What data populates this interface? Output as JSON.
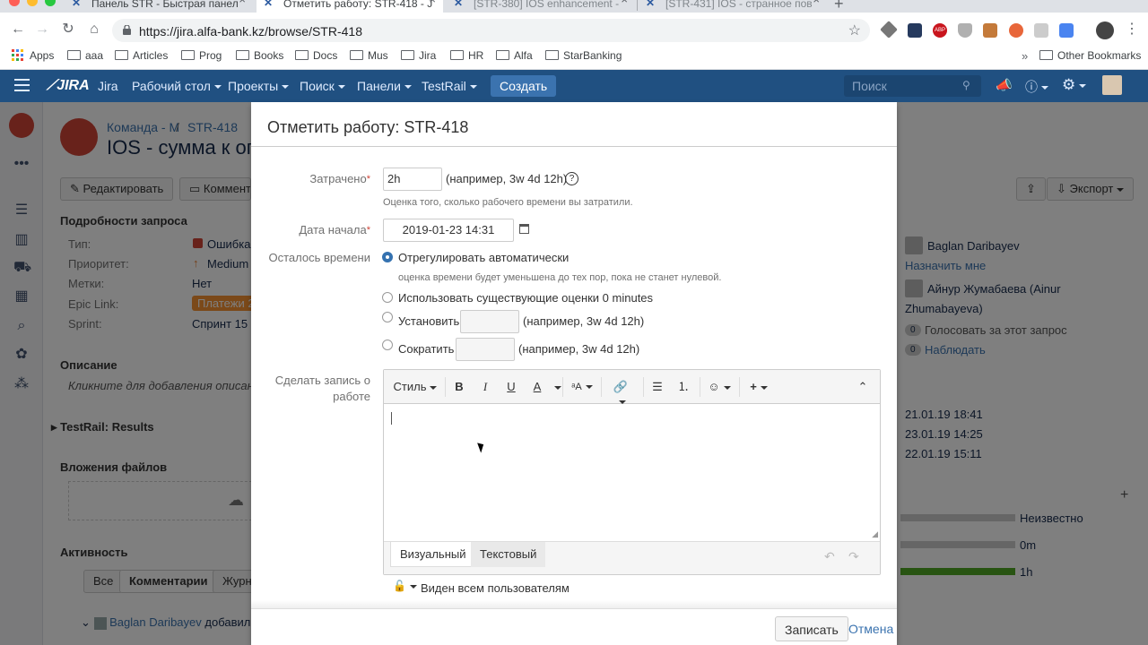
{
  "browser": {
    "tabs": [
      {
        "label": "Панель STR - Быстрая панел"
      },
      {
        "label": "Отметить работу: STR-418 - J"
      },
      {
        "label": "[STR-380] IOS enhancement -"
      },
      {
        "label": "[STR-431] IOS - странное пов"
      }
    ],
    "url": "https://jira.alfa-bank.kz/browse/STR-418",
    "bookmarks": [
      "Apps",
      "aaa",
      "Articles",
      "Prog",
      "Books",
      "Docs",
      "Mus",
      "Jira",
      "HR",
      "Alfa",
      "StarBanking"
    ],
    "other_bookmarks": "Other Bookmarks"
  },
  "jira_header": {
    "logo": "JIRA",
    "nav": [
      "Jira",
      "Рабочий стол",
      "Проекты",
      "Поиск",
      "Панели",
      "TestRail"
    ],
    "create_label": "Создать",
    "search_placeholder": "Поиск"
  },
  "issue": {
    "breadcrumb_project": "Команда - М",
    "breadcrumb_sep": "/",
    "breadcrumb_key": "STR-418",
    "title": "IOS - сумма к оп",
    "edit_label": "Редактировать",
    "comment_label": "Коммента",
    "export_label": "Экспорт",
    "details_heading": "Подробности запроса",
    "details": [
      {
        "label": "Тип:",
        "value": "Ошибка"
      },
      {
        "label": "Приоритет:",
        "value": "Medium"
      },
      {
        "label": "Метки:",
        "value": "Нет"
      },
      {
        "label": "Epic Link:",
        "value": "Платежи 2"
      },
      {
        "label": "Sprint:",
        "value": "Спринт 15 2"
      }
    ],
    "description_heading": "Описание",
    "description_placeholder": "Кликните для добавления описан",
    "testrail_heading": "TestRail: Results",
    "attachments_heading": "Вложения файлов",
    "activity_heading": "Активность",
    "activity_tabs": [
      "Все",
      "Комментарии",
      "Журна"
    ],
    "activity_entry_user": "Baglan Daribayev",
    "activity_entry_text": "добавил к",
    "right": {
      "assignee": "Baglan Daribayev",
      "assign_me": "Назначить мне",
      "reporter": "Айнур Жумабаева (Ainur",
      "reporter2": "Zhumabayeva)",
      "votes_count": "0",
      "votes_label": "Голосовать за этот запрос",
      "watch_count": "0",
      "watch_label": "Наблюдать",
      "dates": [
        "21.01.19 18:41",
        "23.01.19 14:25",
        "22.01.19 15:11"
      ],
      "time_rows": [
        {
          "label": "Неизвестно",
          "fill": 0,
          "color": "#cccccc"
        },
        {
          "label": "0m",
          "fill": 0,
          "color": "#cccccc"
        },
        {
          "label": "1h",
          "fill": 1,
          "color": "#51a825"
        }
      ]
    }
  },
  "dialog": {
    "title": "Отметить работу: STR-418",
    "spent_label": "Затрачено",
    "spent_value": "2h",
    "spent_example": "(например, 3w 4d 12h)",
    "spent_hint": "Оценка того, сколько рабочего времени вы затратили.",
    "start_label": "Дата начала",
    "start_value": "2019-01-23 14:31",
    "remaining_label": "Осталось времени",
    "options": [
      {
        "label": "Отрегулировать автоматически",
        "selected": true
      },
      {
        "label": "Использовать существующие оценки 0 minutes",
        "selected": false
      },
      {
        "label": "Установить",
        "selected": false
      },
      {
        "label": "Сократить",
        "selected": false
      }
    ],
    "auto_hint": "оценка времени будет уменьшена до тех пор, пока не станет нулевой.",
    "set_example": "(например, 3w 4d 12h)",
    "reduce_example": "(например, 3w 4d 12h)",
    "worklog_label_1": "Сделать запись о",
    "worklog_label_2": "работе",
    "toolbar": {
      "style": "Стиль",
      "bold": "B",
      "italic": "I",
      "underline": "U",
      "color": "A"
    },
    "editor_tabs": [
      "Визуальный",
      "Текстовый"
    ],
    "visibility": "Виден всем пользователям",
    "submit_label": "Записать",
    "cancel_label": "Отмена"
  }
}
